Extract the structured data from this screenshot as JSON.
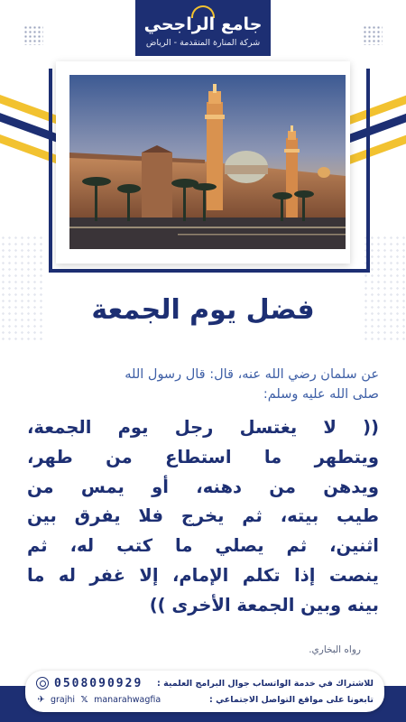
{
  "header": {
    "logo_title": "جامع الراجحي",
    "logo_subtitle": "شركة المنارة المتقدمة - الرياض"
  },
  "photo": {
    "icon": "mosque-photo"
  },
  "content": {
    "title": "فضل يوم الجمعة",
    "narrator_line_1": "عن سلمان رضي الله عنه، قال: قال رسول الله",
    "narrator_line_2": "صلى الله عليه وسلم:",
    "hadith_lines": [
      "(( لا يغتسل رجل يوم الجمعة،",
      "ويتطهر ما استطاع من طهر،",
      "ويدهن من دهنه، أو يمس من",
      "طيب بيته، ثم يخرج فلا يفرق بين",
      "اثنين، ثم يصلي ما كتب له، ثم",
      "ينصت إذا تكلم الإمام، إلا غفر له ما",
      "بينه وبين الجمعة الأخرى ))"
    ],
    "source": "رواه البخاري."
  },
  "footer": {
    "subscribe_text": "للاشتراك في خدمة الواتساب جوال البرامج العلمية :",
    "phone": "0508090929",
    "follow_text": "تابعونا على مواقع التواصل الاجتماعي :",
    "x_handle": "manarahwagfia",
    "telegram_handle": "grajhi"
  },
  "colors": {
    "navy": "#1d2f73",
    "gold": "#f2c230",
    "accent_text": "#3e5fa6"
  }
}
